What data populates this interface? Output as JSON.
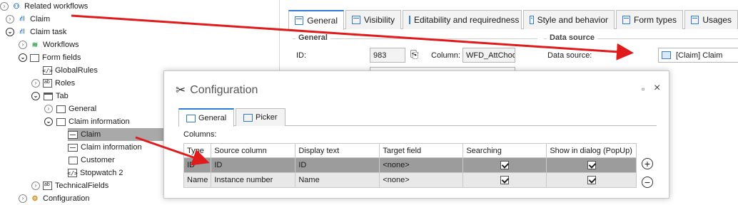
{
  "tree": {
    "items": [
      {
        "label": "Related workflows",
        "icon": "related-workflows-icon"
      },
      {
        "label": "Claim",
        "icon": "workflow-icon"
      },
      {
        "label": "Claim task",
        "icon": "workflow-icon"
      },
      {
        "label": "Workflows",
        "icon": "layers-icon"
      },
      {
        "label": "Form fields",
        "icon": "form-fields-icon"
      },
      {
        "label": "GlobalRules",
        "icon": "code-icon"
      },
      {
        "label": "Roles",
        "icon": "text-field-icon"
      },
      {
        "label": "Tab",
        "icon": "tab-icon"
      },
      {
        "label": "General",
        "icon": "group-icon"
      },
      {
        "label": "Claim information",
        "icon": "group-icon"
      },
      {
        "label": "Claim",
        "icon": "choice-field-icon"
      },
      {
        "label": "Claim information",
        "icon": "text-field-icon"
      },
      {
        "label": "Customer",
        "icon": "group-icon"
      },
      {
        "label": "Stopwatch 2",
        "icon": "code-icon"
      },
      {
        "label": "TechnicalFields",
        "icon": "text-field-icon"
      },
      {
        "label": "Configuration",
        "icon": "configuration-icon"
      }
    ]
  },
  "designer": {
    "tabs": [
      "General",
      "Visibility",
      "Editability and requiredness",
      "Style and behavior",
      "Form types",
      "Usages"
    ],
    "general_group": "General",
    "id_label": "ID:",
    "id_value": "983",
    "column_label": "Column:",
    "column_value": "WFD_AttChoo",
    "datasource_group": "Data source",
    "datasource_label": "Data source:",
    "datasource_value": "[Claim] Claim"
  },
  "dialog": {
    "title": "Configuration",
    "minimize": "▫",
    "close": "×",
    "tabs": [
      "General",
      "Picker"
    ],
    "columns_label": "Columns:",
    "grid": {
      "headers": [
        "Type",
        "Source column",
        "Display text",
        "Target field",
        "Searching",
        "Show in dialog (PopUp)"
      ],
      "rows": [
        {
          "type": "ID",
          "source": "ID",
          "display": "ID",
          "target": "<none>",
          "searching": true,
          "show": true
        },
        {
          "type": "Name",
          "source": "Instance number",
          "display": "Name",
          "target": "<none>",
          "searching": true,
          "show": true
        }
      ]
    },
    "add_button": "+",
    "remove_button": "−"
  },
  "colors": {
    "accent": "#2f7bd6",
    "arrow": "#e01b1b",
    "selected_row": "#9c9c9c"
  }
}
